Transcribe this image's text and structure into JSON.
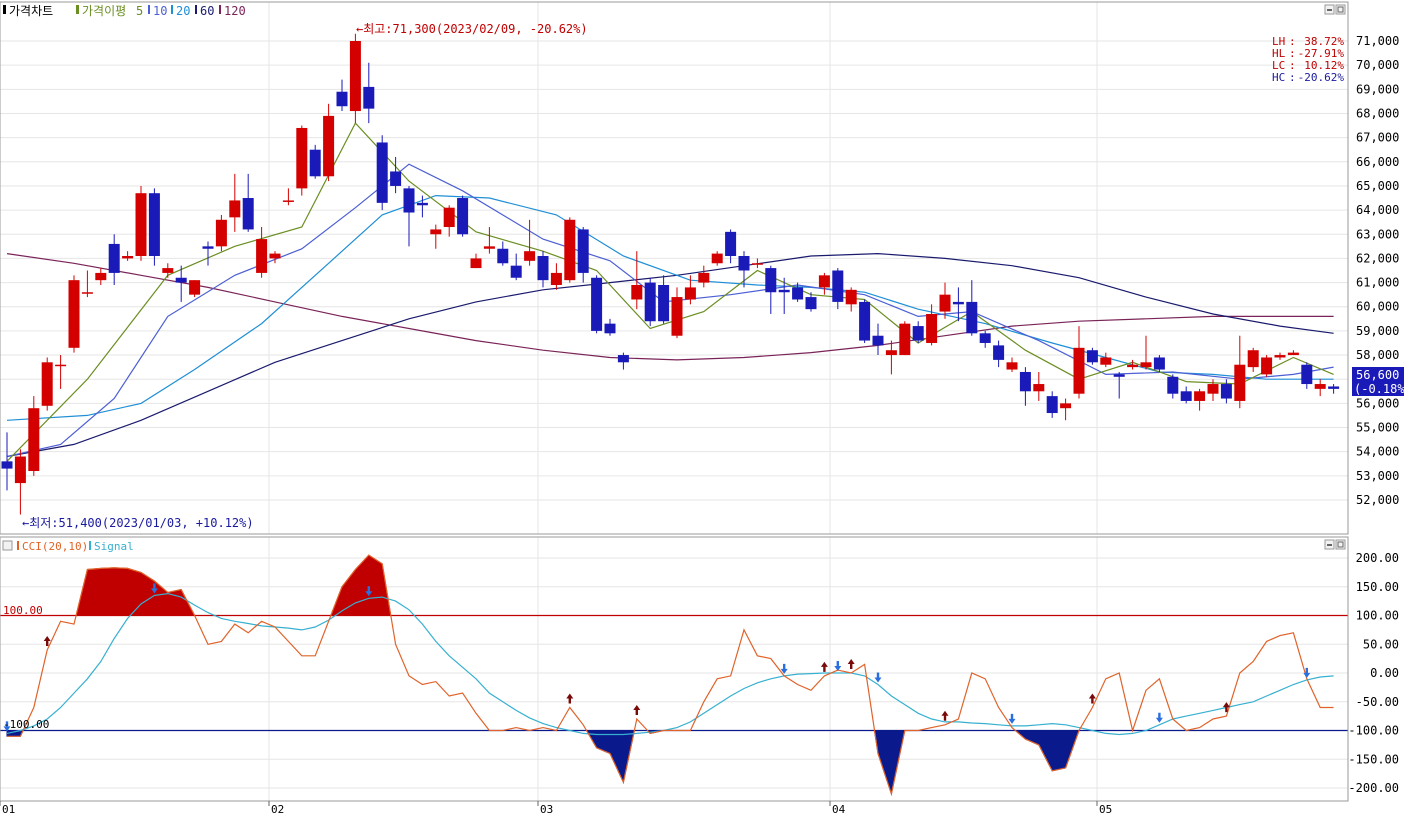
{
  "main_panel": {
    "legend": {
      "chart_label": "가격차트",
      "ma_label": "가격이평",
      "ma_periods": [
        "5",
        "10",
        "20",
        "60",
        "120"
      ],
      "ma_colors": [
        "#6b8e23",
        "#4c5fd4",
        "#1f8fd6",
        "#1a1a6e",
        "#7a2358"
      ]
    },
    "high_marker": "←최고:71,300(2023/02/09, -20.62%)",
    "low_marker": "←최저:51,400(2023/01/03, +10.12%)",
    "stats": [
      {
        "label": "LH",
        "value": "38.72%"
      },
      {
        "label": "HL",
        "value": "-27.91%"
      },
      {
        "label": "LC",
        "value": "10.12%"
      },
      {
        "label": "HC",
        "value": "-20.62%"
      }
    ],
    "y_ticks": [
      "71,000",
      "70,000",
      "69,000",
      "68,000",
      "67,000",
      "66,000",
      "65,000",
      "64,000",
      "63,000",
      "62,000",
      "61,000",
      "60,000",
      "59,000",
      "58,000",
      "57,000",
      "56,000",
      "55,000",
      "54,000",
      "53,000",
      "52,000"
    ],
    "current_price": "56,600",
    "current_change": "(-0.18%)"
  },
  "cci_panel": {
    "legend": {
      "cci_label": "CCI(20,10)",
      "signal_label": "Signal"
    },
    "y_ticks": [
      "200.00",
      "150.00",
      "100.00",
      "50.00",
      "0.00",
      "-50.00",
      "-100.00",
      "-150.00",
      "-200.00"
    ],
    "upper_line_label": "100.00",
    "lower_line_label": "-100.00"
  },
  "x_axis": {
    "labels": [
      "01",
      "02",
      "03",
      "04",
      "05"
    ]
  },
  "colors": {
    "up": "#d40000",
    "down": "#1a1ab8",
    "cci": "#e0632a",
    "signal": "#37b0d0",
    "band_up": "#c00000",
    "band_down": "#0a1a8c",
    "grid": "#e6e6e6"
  },
  "chart_data": {
    "type": "candlestick",
    "x_labels": [
      "01",
      "02",
      "03",
      "04",
      "05"
    ],
    "candles": [
      [
        53.6,
        53.3,
        54.8,
        52.4
      ],
      [
        52.7,
        53.8,
        54.1,
        51.4
      ],
      [
        53.2,
        55.8,
        56.3,
        53.0
      ],
      [
        55.9,
        57.7,
        57.9,
        55.7
      ],
      [
        57.6,
        57.6,
        58.0,
        56.6
      ],
      [
        58.3,
        61.1,
        61.3,
        58.1
      ],
      [
        60.6,
        60.6,
        61.5,
        60.4
      ],
      [
        61.1,
        61.4,
        61.6,
        60.9
      ],
      [
        62.6,
        61.4,
        63.0,
        60.9
      ],
      [
        62.0,
        62.1,
        62.3,
        61.9
      ],
      [
        62.1,
        64.7,
        65.0,
        61.9
      ],
      [
        64.7,
        62.1,
        64.9,
        61.7
      ],
      [
        61.4,
        61.6,
        61.8,
        61.2
      ],
      [
        61.2,
        61.0,
        61.7,
        60.2
      ],
      [
        60.5,
        61.1,
        61.1,
        60.4
      ],
      [
        62.5,
        62.4,
        62.7,
        61.7
      ],
      [
        62.5,
        63.6,
        63.8,
        62.3
      ],
      [
        63.7,
        64.4,
        65.5,
        63.1
      ],
      [
        64.5,
        63.2,
        65.5,
        63.1
      ],
      [
        61.4,
        62.8,
        63.3,
        61.2
      ],
      [
        62.0,
        62.2,
        62.3,
        61.8
      ],
      [
        64.4,
        64.4,
        64.9,
        64.2
      ],
      [
        64.9,
        67.4,
        67.5,
        64.6
      ],
      [
        66.5,
        65.4,
        66.7,
        65.3
      ],
      [
        65.4,
        67.9,
        68.4,
        65.2
      ],
      [
        68.9,
        68.3,
        69.4,
        68.1
      ],
      [
        68.1,
        71.0,
        71.3,
        67.6
      ],
      [
        69.1,
        68.2,
        70.1,
        67.6
      ],
      [
        66.8,
        64.3,
        67.1,
        64.0
      ],
      [
        65.6,
        65.0,
        66.2,
        64.7
      ],
      [
        64.9,
        63.9,
        65.0,
        62.5
      ],
      [
        64.3,
        64.2,
        64.6,
        63.7
      ],
      [
        63.0,
        63.2,
        63.4,
        62.4
      ],
      [
        63.3,
        64.1,
        64.2,
        62.9
      ],
      [
        64.5,
        63.0,
        64.6,
        62.9
      ],
      [
        61.6,
        62.0,
        62.2,
        61.6
      ],
      [
        62.4,
        62.5,
        63.3,
        62.2
      ],
      [
        62.4,
        61.8,
        62.7,
        61.7
      ],
      [
        61.7,
        61.2,
        62.2,
        61.1
      ],
      [
        61.9,
        62.3,
        63.6,
        61.7
      ],
      [
        62.1,
        61.1,
        62.3,
        60.8
      ],
      [
        60.9,
        61.4,
        61.8,
        60.7
      ],
      [
        61.1,
        63.6,
        63.7,
        61.0
      ],
      [
        63.2,
        61.4,
        63.3,
        61.0
      ],
      [
        61.2,
        59.0,
        61.3,
        58.9
      ],
      [
        59.3,
        58.9,
        59.5,
        58.8
      ],
      [
        58.0,
        57.7,
        58.1,
        57.4
      ],
      [
        60.3,
        60.9,
        62.3,
        59.9
      ],
      [
        61.0,
        59.4,
        61.2,
        59.2
      ],
      [
        60.9,
        59.4,
        61.3,
        59.3
      ],
      [
        58.8,
        60.4,
        60.8,
        58.7
      ],
      [
        60.3,
        60.8,
        61.3,
        60.1
      ],
      [
        61.0,
        61.4,
        61.7,
        60.8
      ],
      [
        61.8,
        62.2,
        62.3,
        61.7
      ],
      [
        63.1,
        62.1,
        63.2,
        61.8
      ],
      [
        62.1,
        61.5,
        62.3,
        60.8
      ],
      [
        61.8,
        61.8,
        62.0,
        61.6
      ],
      [
        61.6,
        60.6,
        61.7,
        59.7
      ],
      [
        60.7,
        60.6,
        61.2,
        59.7
      ],
      [
        60.8,
        60.3,
        61.0,
        60.2
      ],
      [
        60.4,
        59.9,
        60.6,
        59.8
      ],
      [
        60.8,
        61.3,
        61.4,
        60.5
      ],
      [
        61.5,
        60.2,
        61.6,
        59.9
      ],
      [
        60.1,
        60.7,
        60.8,
        59.8
      ],
      [
        60.2,
        58.6,
        60.3,
        58.5
      ],
      [
        58.8,
        58.4,
        59.3,
        58.0
      ],
      [
        58.0,
        58.2,
        58.6,
        57.2
      ],
      [
        58.0,
        59.3,
        59.4,
        58.0
      ],
      [
        59.2,
        58.6,
        59.4,
        58.5
      ],
      [
        58.5,
        59.7,
        60.1,
        58.4
      ],
      [
        59.8,
        60.5,
        61.0,
        59.5
      ],
      [
        60.2,
        60.1,
        60.8,
        59.4
      ],
      [
        60.2,
        58.9,
        61.1,
        58.8
      ],
      [
        58.9,
        58.5,
        59.0,
        58.3
      ],
      [
        58.4,
        57.8,
        58.6,
        57.5
      ],
      [
        57.4,
        57.7,
        57.9,
        57.3
      ],
      [
        57.3,
        56.5,
        57.5,
        55.9
      ],
      [
        56.5,
        56.8,
        57.3,
        56.1
      ],
      [
        56.3,
        55.6,
        56.5,
        55.4
      ],
      [
        55.8,
        56.0,
        56.2,
        55.3
      ],
      [
        56.4,
        58.3,
        59.2,
        56.2
      ],
      [
        58.2,
        57.7,
        58.3,
        57.6
      ],
      [
        57.6,
        57.9,
        58.1,
        57.5
      ],
      [
        57.2,
        57.1,
        57.3,
        56.2
      ],
      [
        57.5,
        57.6,
        57.8,
        57.4
      ],
      [
        57.5,
        57.7,
        58.8,
        57.4
      ],
      [
        57.9,
        57.4,
        58.0,
        57.3
      ],
      [
        57.1,
        56.4,
        57.2,
        56.2
      ],
      [
        56.5,
        56.1,
        56.7,
        56.0
      ],
      [
        56.1,
        56.5,
        56.6,
        55.7
      ],
      [
        56.4,
        56.8,
        57.0,
        56.1
      ],
      [
        56.8,
        56.2,
        57.0,
        56.0
      ],
      [
        56.1,
        57.6,
        58.8,
        55.8
      ],
      [
        57.5,
        58.2,
        58.3,
        57.3
      ],
      [
        57.2,
        57.9,
        58.0,
        57.1
      ],
      [
        57.9,
        58.0,
        58.1,
        57.8
      ],
      [
        58.0,
        58.1,
        58.2,
        58.0
      ],
      [
        57.6,
        56.8,
        57.7,
        56.6
      ],
      [
        56.6,
        56.8,
        57.0,
        56.3
      ],
      [
        56.7,
        56.6,
        56.8,
        56.4
      ]
    ],
    "ma": {
      "5": [
        [
          0,
          53.6
        ],
        [
          6,
          57.0
        ],
        [
          12,
          61.3
        ],
        [
          17,
          62.5
        ],
        [
          22,
          63.3
        ],
        [
          26,
          67.6
        ],
        [
          30,
          65.2
        ],
        [
          35,
          63.1
        ],
        [
          40,
          62.3
        ],
        [
          44,
          61.5
        ],
        [
          48,
          59.1
        ],
        [
          52,
          59.8
        ],
        [
          56,
          61.5
        ],
        [
          60,
          60.5
        ],
        [
          64,
          60.3
        ],
        [
          68,
          58.5
        ],
        [
          72,
          59.8
        ],
        [
          76,
          58.2
        ],
        [
          80,
          57.0
        ],
        [
          84,
          57.7
        ],
        [
          88,
          56.9
        ],
        [
          92,
          56.8
        ],
        [
          96,
          57.9
        ],
        [
          99,
          57.2
        ]
      ],
      "10": [
        [
          0,
          53.8
        ],
        [
          4,
          54.3
        ],
        [
          8,
          56.2
        ],
        [
          12,
          59.6
        ],
        [
          17,
          61.3
        ],
        [
          22,
          62.4
        ],
        [
          26,
          64.1
        ],
        [
          30,
          65.9
        ],
        [
          34,
          64.8
        ],
        [
          40,
          62.8
        ],
        [
          45,
          61.9
        ],
        [
          49,
          60.2
        ],
        [
          54,
          60.5
        ],
        [
          59,
          60.9
        ],
        [
          64,
          60.5
        ],
        [
          68,
          59.6
        ],
        [
          72,
          59.8
        ],
        [
          77,
          58.6
        ],
        [
          82,
          57.2
        ],
        [
          87,
          57.3
        ],
        [
          92,
          57.0
        ],
        [
          96,
          57.2
        ],
        [
          99,
          57.5
        ]
      ],
      "20": [
        [
          0,
          55.3
        ],
        [
          6,
          55.5
        ],
        [
          10,
          56.0
        ],
        [
          14,
          57.4
        ],
        [
          19,
          59.3
        ],
        [
          24,
          61.8
        ],
        [
          28,
          63.8
        ],
        [
          32,
          64.6
        ],
        [
          36,
          64.5
        ],
        [
          41,
          63.8
        ],
        [
          46,
          62.1
        ],
        [
          51,
          61.1
        ],
        [
          56,
          60.9
        ],
        [
          60,
          60.8
        ],
        [
          64,
          60.6
        ],
        [
          68,
          59.9
        ],
        [
          73,
          59.3
        ],
        [
          78,
          58.5
        ],
        [
          82,
          57.9
        ],
        [
          86,
          57.3
        ],
        [
          90,
          57.2
        ],
        [
          94,
          57.0
        ],
        [
          99,
          57.0
        ]
      ],
      "60": [
        [
          0,
          53.8
        ],
        [
          5,
          54.3
        ],
        [
          10,
          55.3
        ],
        [
          15,
          56.5
        ],
        [
          20,
          57.7
        ],
        [
          25,
          58.6
        ],
        [
          30,
          59.5
        ],
        [
          35,
          60.2
        ],
        [
          40,
          60.7
        ],
        [
          45,
          61.0
        ],
        [
          50,
          61.3
        ],
        [
          55,
          61.7
        ],
        [
          60,
          62.1
        ],
        [
          65,
          62.2
        ],
        [
          70,
          62.0
        ],
        [
          75,
          61.7
        ],
        [
          80,
          61.2
        ],
        [
          85,
          60.4
        ],
        [
          90,
          59.7
        ],
        [
          95,
          59.2
        ],
        [
          99,
          58.9
        ]
      ],
      "120": [
        [
          0,
          62.2
        ],
        [
          5,
          61.8
        ],
        [
          10,
          61.3
        ],
        [
          15,
          60.8
        ],
        [
          20,
          60.2
        ],
        [
          25,
          59.6
        ],
        [
          30,
          59.1
        ],
        [
          35,
          58.6
        ],
        [
          40,
          58.2
        ],
        [
          45,
          57.9
        ],
        [
          50,
          57.8
        ],
        [
          55,
          57.9
        ],
        [
          60,
          58.1
        ],
        [
          65,
          58.4
        ],
        [
          70,
          58.8
        ],
        [
          75,
          59.2
        ],
        [
          80,
          59.4
        ],
        [
          85,
          59.5
        ],
        [
          90,
          59.6
        ],
        [
          95,
          59.6
        ],
        [
          99,
          59.6
        ]
      ]
    },
    "cci": [
      -110,
      -110,
      -60,
      40,
      90,
      85,
      180,
      182,
      183,
      182,
      175,
      160,
      140,
      145,
      100,
      50,
      55,
      85,
      70,
      90,
      80,
      55,
      30,
      30,
      90,
      150,
      180,
      205,
      190,
      50,
      -5,
      -20,
      -15,
      -40,
      -35,
      -70,
      -100,
      -100,
      -95,
      -100,
      -95,
      -100,
      -60,
      -90,
      -130,
      -140,
      -190,
      -80,
      -105,
      -100,
      -100,
      -100,
      -50,
      -10,
      -5,
      75,
      30,
      25,
      -5,
      -20,
      -30,
      -5,
      5,
      0,
      15,
      -140,
      -210,
      -100,
      -100,
      -95,
      -90,
      -80,
      0,
      -10,
      -60,
      -95,
      -115,
      -125,
      -170,
      -165,
      -100,
      -60,
      -10,
      0,
      -100,
      -30,
      -10,
      -80,
      -100,
      -95,
      -80,
      -75,
      0,
      20,
      55,
      65,
      70,
      -10,
      -60,
      -60
    ],
    "signal": [
      -105,
      -100,
      -92,
      -80,
      -60,
      -35,
      -10,
      20,
      60,
      95,
      120,
      135,
      138,
      132,
      118,
      105,
      95,
      90,
      86,
      82,
      80,
      78,
      75,
      80,
      92,
      108,
      122,
      130,
      132,
      125,
      110,
      85,
      55,
      30,
      10,
      -10,
      -35,
      -50,
      -65,
      -78,
      -88,
      -95,
      -100,
      -105,
      -107,
      -107,
      -107,
      -105,
      -103,
      -100,
      -95,
      -85,
      -70,
      -55,
      -40,
      -27,
      -17,
      -10,
      -5,
      -2,
      -1,
      0,
      0,
      0,
      -5,
      -20,
      -40,
      -55,
      -70,
      -80,
      -85,
      -85,
      -87,
      -88,
      -90,
      -92,
      -92,
      -90,
      -88,
      -90,
      -95,
      -100,
      -105,
      -107,
      -105,
      -100,
      -90,
      -80,
      -75,
      -70,
      -65,
      -60,
      -55,
      -50,
      -40,
      -30,
      -20,
      -12,
      -7,
      -5
    ],
    "up_arrows": [
      3,
      42,
      47,
      61,
      63,
      70,
      81,
      91
    ],
    "down_arrows": [
      0,
      11,
      27,
      58,
      62,
      65,
      75,
      86,
      97
    ],
    "ylim_price": [
      51.0,
      71.6
    ],
    "ylim_cci": [
      -220,
      220
    ]
  }
}
